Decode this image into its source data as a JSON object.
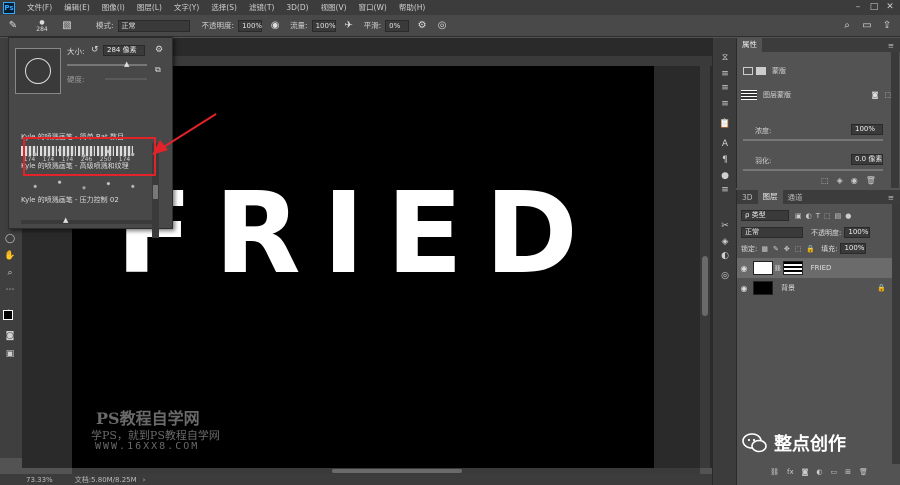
{
  "menubar": {
    "logo": "Ps",
    "items": [
      "文件(F)",
      "编辑(E)",
      "图像(I)",
      "图层(L)",
      "文字(Y)",
      "选择(S)",
      "滤镜(T)",
      "3D(D)",
      "视图(V)",
      "窗口(W)",
      "帮助(H)"
    ]
  },
  "options": {
    "brush_size": "284",
    "mode_label": "模式:",
    "mode_value": "正常",
    "opacity_label": "不透明度:",
    "opacity_value": "100%",
    "flow_label": "流量:",
    "flow_value": "100%",
    "smoothing_label": "平滑:",
    "smoothing_value": "0%"
  },
  "brush_panel": {
    "size_label": "大小:",
    "size_value": "284 像素",
    "hardness_label": "硬度:",
    "thumb_sizes": [
      "174",
      "174",
      "174",
      "246",
      "250",
      "174"
    ],
    "rows": [
      "Kyle 的喷溅画笔 - 简单 Bat 数目",
      "Kyle 的喷溅画笔 - 高级喷溅和纹理",
      "Kyle 的喷溅画笔 - 压力控制 02"
    ]
  },
  "canvas": {
    "text": "FRIED",
    "watermark_title": "PS教程自学网",
    "watermark_slogan": "学PS，就到PS教程自学网",
    "watermark_url": "WWW.16XX8.COM"
  },
  "status": {
    "zoom": "73.33%",
    "doc": "文档:5.80M/8.25M"
  },
  "properties": {
    "tab": "属性",
    "section": "蒙版",
    "mask_type": "图层蒙版",
    "density_label": "浓度:",
    "density_value": "100%",
    "feather_label": "羽化:",
    "feather_value": "0.0 像素"
  },
  "layers": {
    "tabs": [
      "3D",
      "图层",
      "通道"
    ],
    "filter_label": "ρ 类型",
    "blend_mode": "正常",
    "opacity_label": "不透明度:",
    "opacity_value": "100%",
    "lock_label": "锁定:",
    "fill_label": "填充:",
    "fill_value": "100%",
    "items": [
      {
        "name": "FRIED",
        "selected": true
      },
      {
        "name": "背景",
        "selected": false
      }
    ]
  },
  "brand": {
    "text": "整点创作"
  },
  "colors": {
    "highlight": "#e2232a",
    "canvas_bg": "#000000",
    "text": "#ffffff"
  }
}
